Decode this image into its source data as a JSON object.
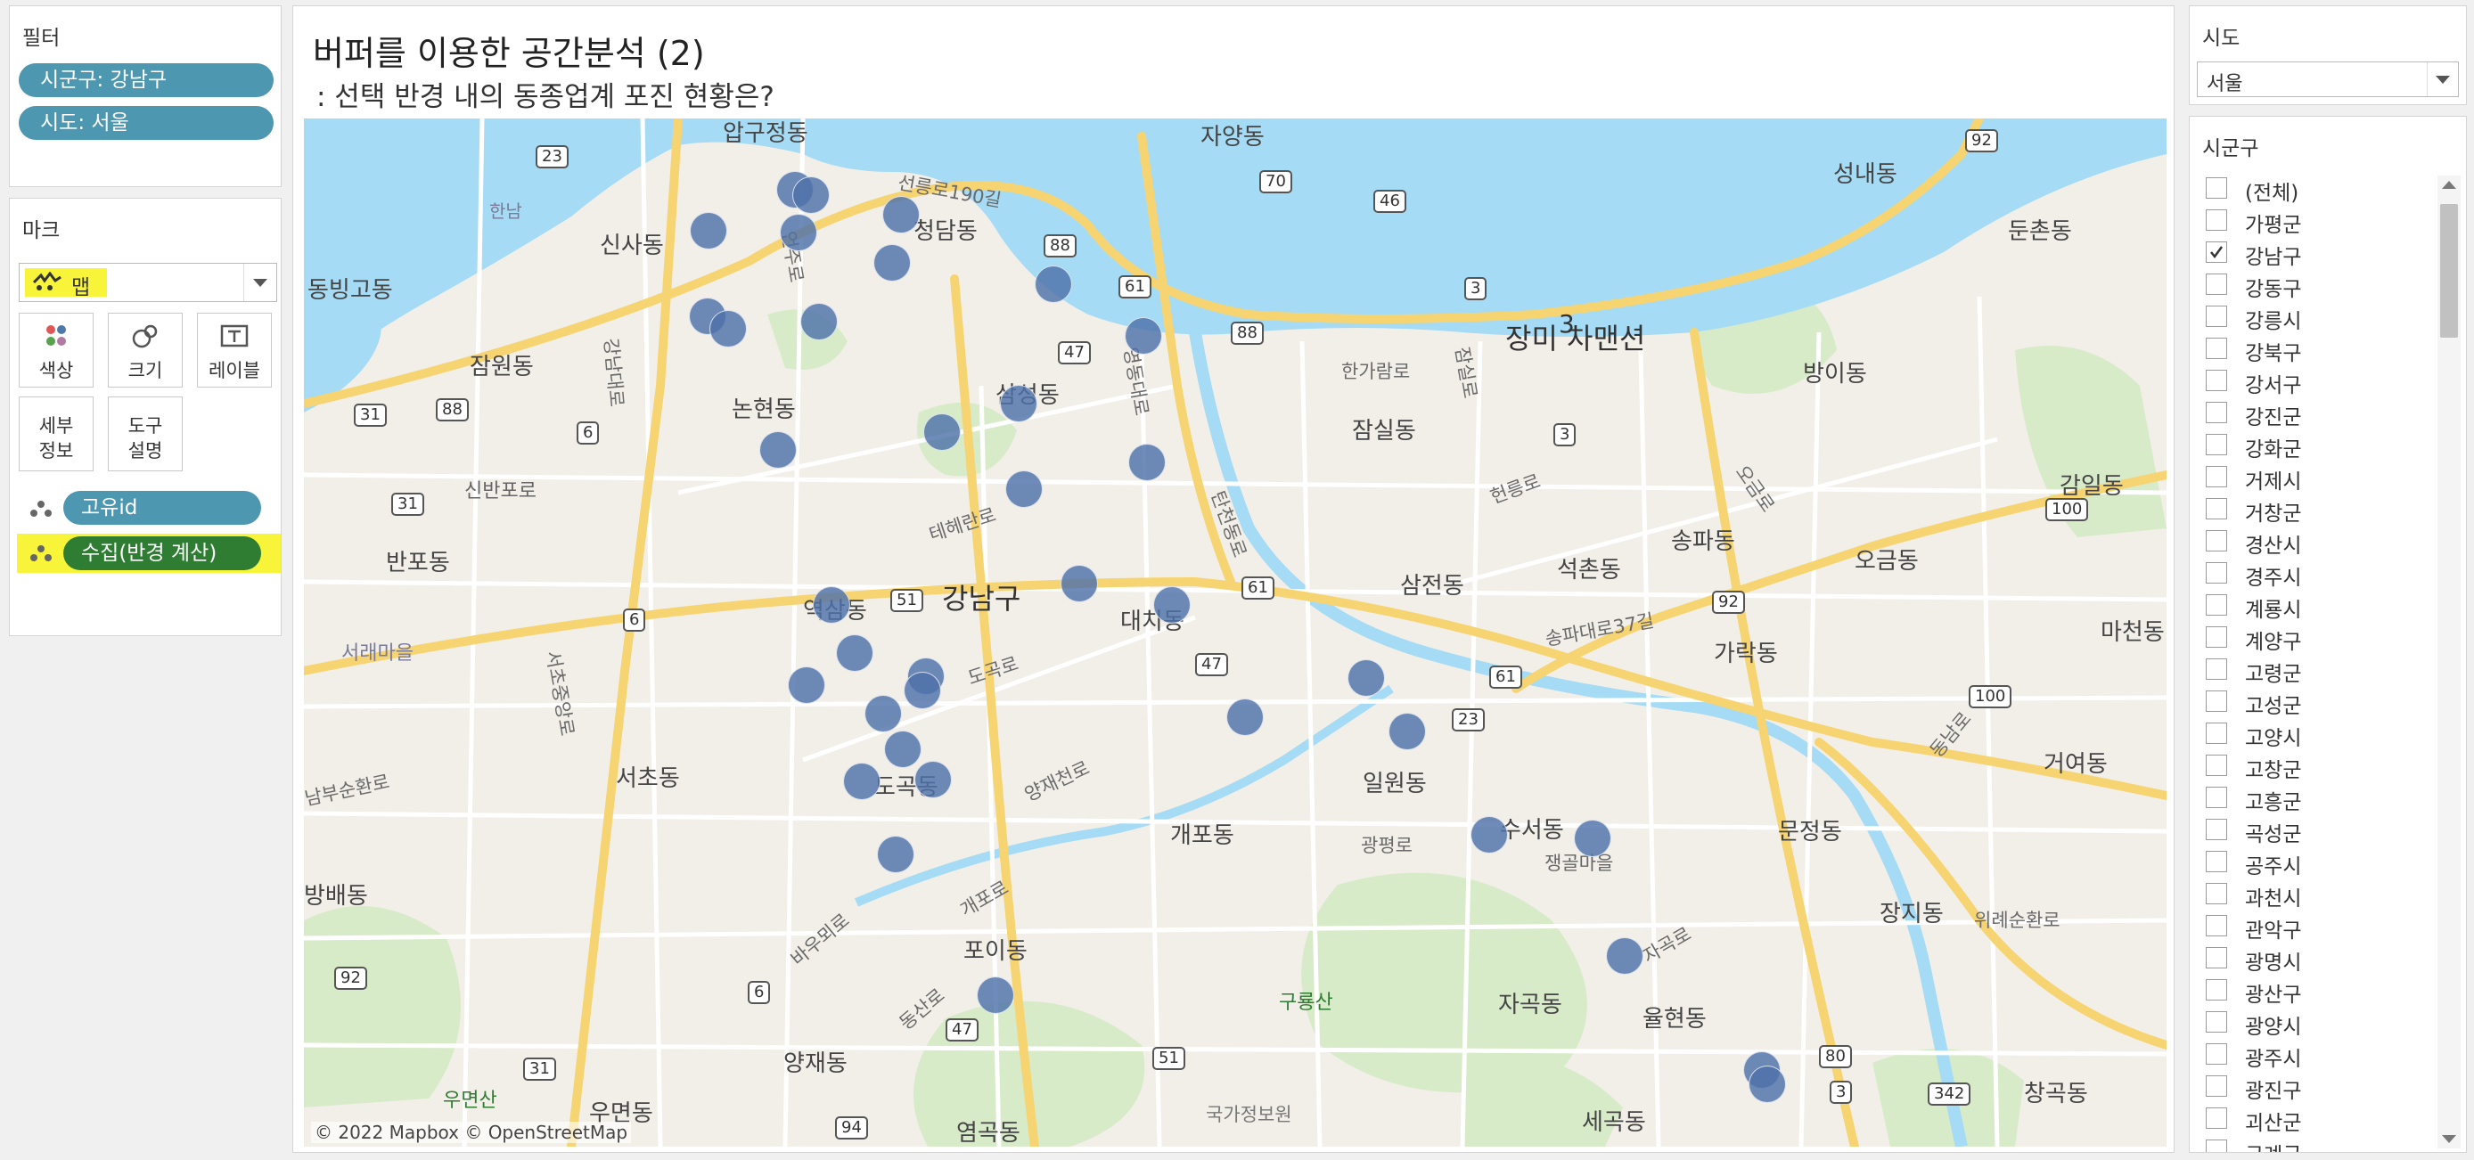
{
  "filters": {
    "title": "필터",
    "pills": [
      "시군구: 강남구",
      "시도: 서울"
    ]
  },
  "marks": {
    "title": "마크",
    "mark_type": "맵",
    "buttons": [
      {
        "label": "색상",
        "icon": "color-icon"
      },
      {
        "label": "크기",
        "icon": "size-icon"
      },
      {
        "label": "레이블",
        "icon": "label-icon"
      },
      {
        "label": "세부\n정보",
        "icon": "detail-icon"
      },
      {
        "label": "도구\n설명",
        "icon": "tooltip-icon"
      }
    ],
    "fields": [
      "고유id",
      "수집(반경 계산)"
    ],
    "highlight_color": "#f7f43a",
    "field_color": "#4e97b0"
  },
  "header": {
    "title": "버퍼를 이용한 공간분석 (2)",
    "subtitle": ": 선택 반경 내의 동종업계 포진 현황은?"
  },
  "map": {
    "attribution": "© 2022 Mapbox © OpenStreetMap",
    "district_labels": [
      "압구정동",
      "자양동",
      "신사동",
      "청담동",
      "동빙고동",
      "잠원동",
      "논현동",
      "삼성동",
      "잠실동",
      "장미 차맨션",
      "방이동",
      "성내동",
      "둔촌동",
      "신반포로",
      "반포동",
      "강남구",
      "대치동",
      "삼전동",
      "석촌동",
      "송파동",
      "오금동",
      "가락동",
      "서초동",
      "일원동",
      "개포동",
      "수서동",
      "쟁골마을",
      "문정동",
      "장지동",
      "거여동",
      "방배동",
      "포이동",
      "구룡산",
      "자곡동",
      "율현동",
      "양재동",
      "우면산",
      "우면동",
      "국가정보원",
      "염곡동",
      "세곡동",
      "창곡동",
      "서래마을",
      "도곡동",
      "역삼동",
      "감일동",
      "마천동",
      "한남"
    ],
    "road_labels": [
      "선릉로190길",
      "한가람로",
      "잠실로",
      "탄천동로",
      "테헤란로",
      "도곡로",
      "양재천로",
      "광평로",
      "송파대로37길",
      "오금로",
      "위례순환로",
      "동남로",
      "개포로",
      "바우뫼로",
      "동산로",
      "자곡로",
      "강남대로",
      "언주로",
      "영동대로",
      "서초중앙로",
      "남부순환로",
      "헌릉로"
    ],
    "shields": [
      "23",
      "70",
      "46",
      "88",
      "61",
      "3",
      "47",
      "92",
      "31",
      "88",
      "6",
      "31",
      "6",
      "51",
      "61",
      "47",
      "92",
      "23",
      "3",
      "61",
      "100",
      "100",
      "80",
      "342",
      "94",
      "51",
      "47",
      "6",
      "92",
      "31",
      "3",
      "88"
    ],
    "cluster_label": "3",
    "colors": {
      "water": "#a5dbf5",
      "land": "#f2efe9",
      "park": "#d8ebc9",
      "road": "#ffffff",
      "highway": "#f7d472",
      "dot": "#4e71aa"
    }
  },
  "sido": {
    "title": "시도",
    "selected": "서울"
  },
  "sigungu": {
    "title": "시군구",
    "items": [
      {
        "label": "(전체)",
        "checked": false
      },
      {
        "label": "가평군",
        "checked": false
      },
      {
        "label": "강남구",
        "checked": true
      },
      {
        "label": "강동구",
        "checked": false
      },
      {
        "label": "강릉시",
        "checked": false
      },
      {
        "label": "강북구",
        "checked": false
      },
      {
        "label": "강서구",
        "checked": false
      },
      {
        "label": "강진군",
        "checked": false
      },
      {
        "label": "강화군",
        "checked": false
      },
      {
        "label": "거제시",
        "checked": false
      },
      {
        "label": "거창군",
        "checked": false
      },
      {
        "label": "경산시",
        "checked": false
      },
      {
        "label": "경주시",
        "checked": false
      },
      {
        "label": "계룡시",
        "checked": false
      },
      {
        "label": "계양구",
        "checked": false
      },
      {
        "label": "고령군",
        "checked": false
      },
      {
        "label": "고성군",
        "checked": false
      },
      {
        "label": "고양시",
        "checked": false
      },
      {
        "label": "고창군",
        "checked": false
      },
      {
        "label": "고흥군",
        "checked": false
      },
      {
        "label": "곡성군",
        "checked": false
      },
      {
        "label": "공주시",
        "checked": false
      },
      {
        "label": "과천시",
        "checked": false
      },
      {
        "label": "관악구",
        "checked": false
      },
      {
        "label": "광명시",
        "checked": false
      },
      {
        "label": "광산구",
        "checked": false
      },
      {
        "label": "광양시",
        "checked": false
      },
      {
        "label": "광주시",
        "checked": false
      },
      {
        "label": "광진구",
        "checked": false
      },
      {
        "label": "괴산군",
        "checked": false
      },
      {
        "label": "구례군",
        "checked": false
      }
    ]
  }
}
